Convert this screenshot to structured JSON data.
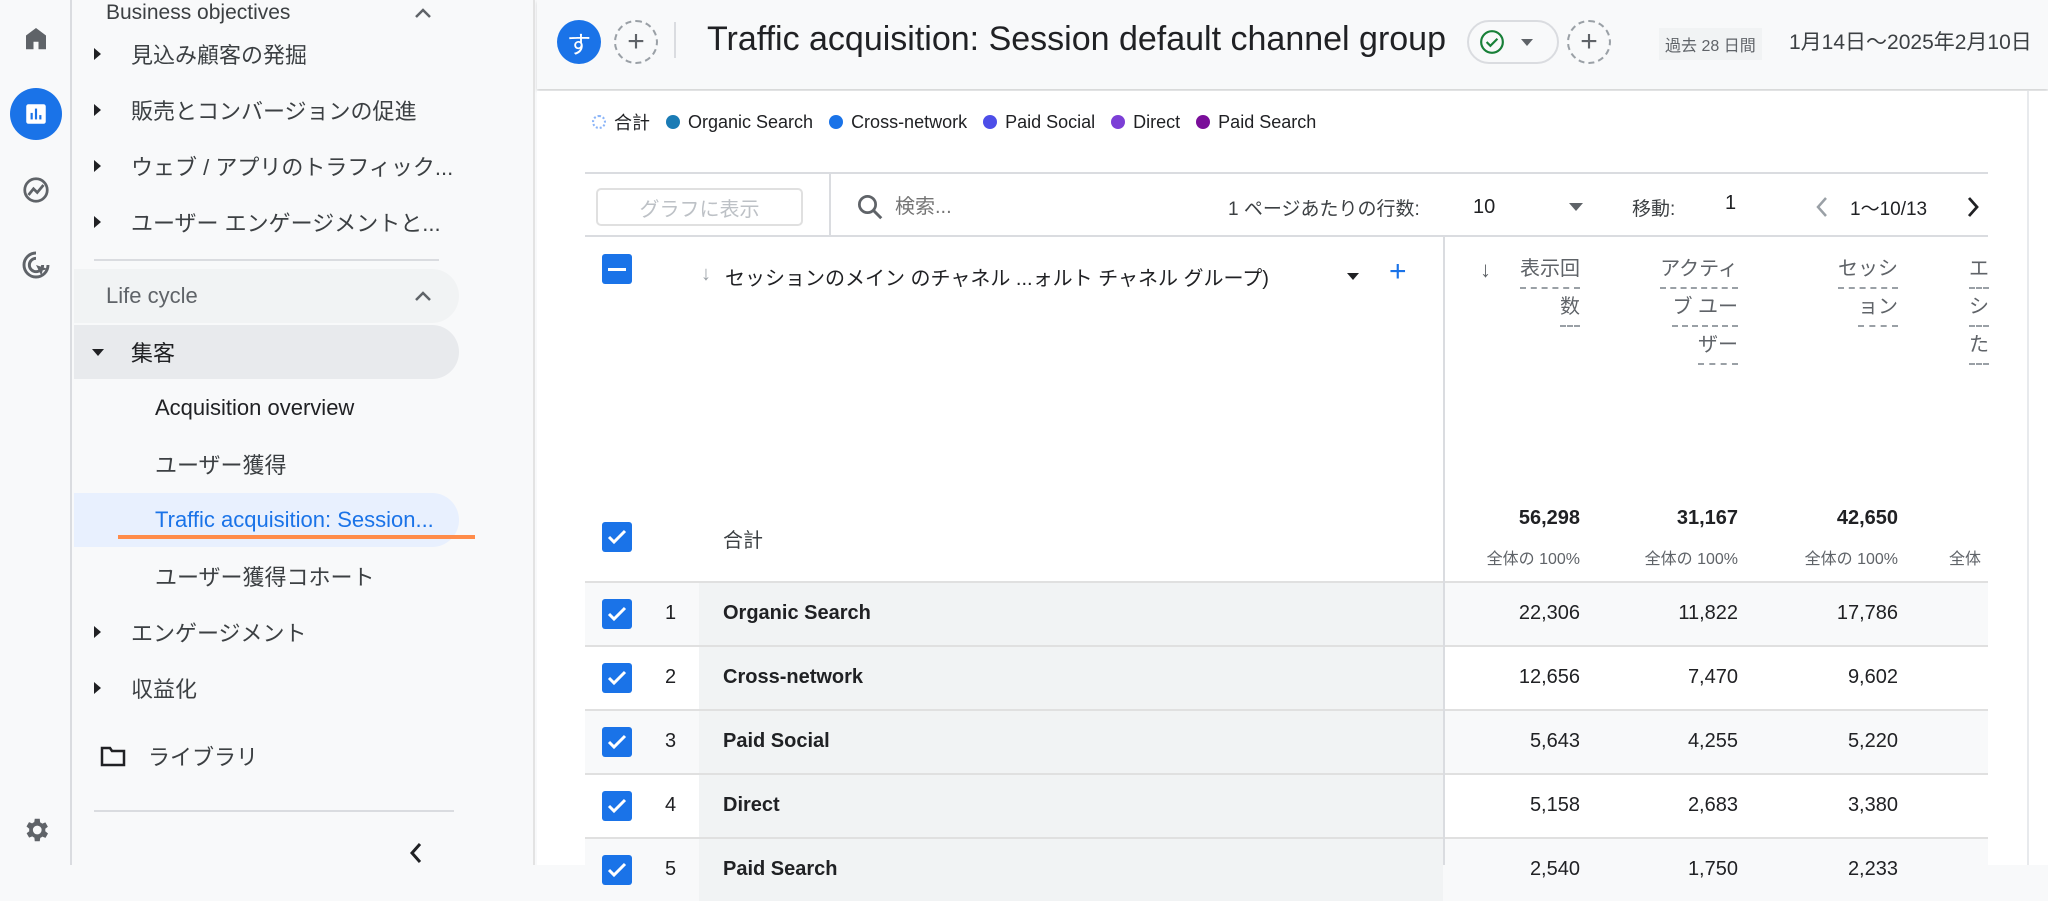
{
  "rail": {
    "icons": [
      "home-icon",
      "reports-icon",
      "explore-icon",
      "advertising-icon",
      "settings-icon"
    ]
  },
  "sidebar": {
    "section_title": "Business objectives",
    "objectives": [
      "見込み顧客の発掘",
      "販売とコンバージョンの促進",
      "ウェブ / アプリのトラフィック...",
      "ユーザー エンゲージメントと..."
    ],
    "lifecycle_title": "Life cycle",
    "acquisition": "集客",
    "acquisition_items": [
      "Acquisition overview",
      "ユーザー獲得",
      "Traffic acquisition: Session...",
      "ユーザー獲得コホート"
    ],
    "engagement": "エンゲージメント",
    "monetization": "収益化",
    "library": "ライブラリ"
  },
  "header": {
    "avatar": "す",
    "title": "Traffic acquisition: Session default channel group",
    "period_chip": "過去 28 日間",
    "date_range": "1月14日〜2025年2月10日"
  },
  "legend": [
    {
      "label": "合計",
      "color": "#8ab4f8"
    },
    {
      "label": "Organic Search",
      "color": "#1a7bb5"
    },
    {
      "label": "Cross-network",
      "color": "#1a73e8"
    },
    {
      "label": "Paid Social",
      "color": "#4d4ee8"
    },
    {
      "label": "Direct",
      "color": "#7c3fd6"
    },
    {
      "label": "Paid Search",
      "color": "#7a0e9a"
    }
  ],
  "toolbar": {
    "graph_button": "グラフに表示",
    "search_placeholder": "検索...",
    "rows_per_page_label": "1 ページあたりの行数:",
    "rows_per_page": "10",
    "goto_label": "移動:",
    "goto_value": "1",
    "page_range": "1〜10/13"
  },
  "table": {
    "dimension_header": "セッションのメイン のチャネル ...ォルト チャネル グループ)",
    "metric_headers": [
      [
        "表示回",
        "数"
      ],
      [
        "アクティ",
        "ブ ユー",
        "ザー"
      ],
      [
        "セッシ",
        "ョン"
      ],
      [
        "エ",
        "シ",
        "た"
      ]
    ],
    "totals": {
      "label": "合計",
      "values": [
        "56,298",
        "31,167",
        "42,650"
      ],
      "pct": [
        "全体の 100%",
        "全体の 100%",
        "全体の 100%",
        "全体"
      ]
    },
    "rows": [
      {
        "n": "1",
        "name": "Organic Search",
        "values": [
          "22,306",
          "11,822",
          "17,786"
        ]
      },
      {
        "n": "2",
        "name": "Cross-network",
        "values": [
          "12,656",
          "7,470",
          "9,602"
        ]
      },
      {
        "n": "3",
        "name": "Paid Social",
        "values": [
          "5,643",
          "4,255",
          "5,220"
        ]
      },
      {
        "n": "4",
        "name": "Direct",
        "values": [
          "5,158",
          "2,683",
          "3,380"
        ]
      },
      {
        "n": "5",
        "name": "Paid Search",
        "values": [
          "2,540",
          "1,750",
          "2,233"
        ]
      }
    ]
  }
}
